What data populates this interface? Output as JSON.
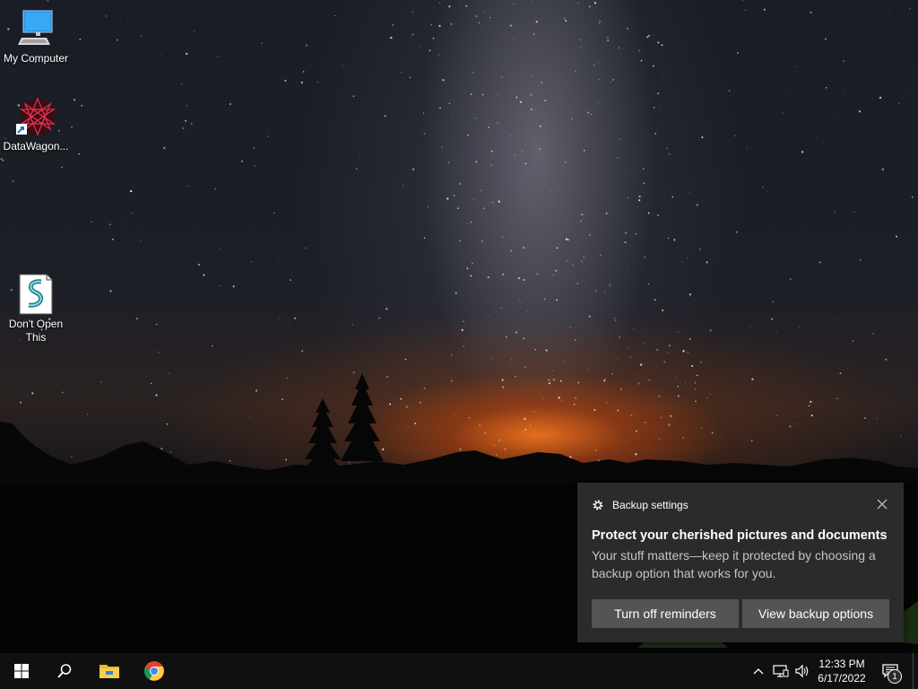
{
  "desktop": {
    "icons": [
      {
        "label": "My Computer",
        "icon": "computer-icon"
      },
      {
        "label": "DataWagon...",
        "icon": "datawagon-icon"
      },
      {
        "label": "Don't Open This",
        "icon": "script-file-icon"
      }
    ]
  },
  "toast": {
    "app_name": "Backup settings",
    "title": "Protect your cherished pictures and documents",
    "body": "Your stuff matters—keep it protected by choosing a backup option that works for you.",
    "buttons": {
      "turn_off": "Turn off reminders",
      "view_options": "View backup options"
    }
  },
  "taskbar": {
    "pinned": [
      "start-icon",
      "search-icon",
      "file-explorer-icon",
      "chrome-icon"
    ],
    "clock": {
      "time": "12:33 PM",
      "date": "6/17/2022"
    },
    "notifications_count": "1"
  },
  "colors": {
    "toast_bg": "#2b2b2b",
    "toast_button": "#545454",
    "taskbar_bg": "#101010",
    "start_blue": "#ffffff"
  }
}
